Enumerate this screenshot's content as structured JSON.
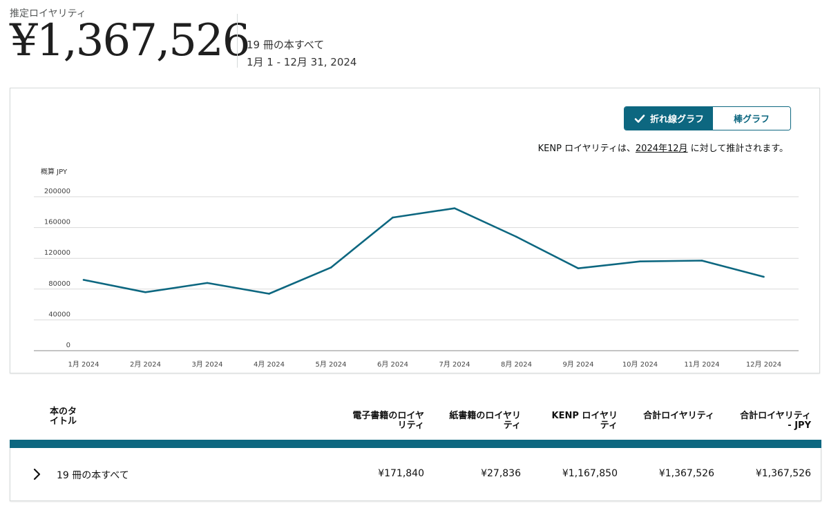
{
  "header": {
    "estimated_label": "推定ロイヤリティ",
    "total": "¥1,367,526",
    "books_label": "19 冊の本すべて",
    "date_range": "1月 1 - 12月 31, 2024"
  },
  "chart_controls": {
    "line_label": "折れ線グラフ",
    "bar_label": "棒グラフ",
    "active": "line"
  },
  "kenp_note": {
    "prefix": "KENP ロイヤリティは、",
    "link": "2024年12月",
    "suffix": " に対して推計されます。"
  },
  "chart_data": {
    "type": "line",
    "ylabel": "概算 JPY",
    "ylim": [
      0,
      200000
    ],
    "yticks": [
      "0",
      "40000",
      "80000",
      "120000",
      "160000",
      "200000"
    ],
    "categories": [
      "1月 2024",
      "2月 2024",
      "3月 2024",
      "4月 2024",
      "5月 2024",
      "6月 2024",
      "7月 2024",
      "8月 2024",
      "9月 2024",
      "10月 2024",
      "11月 2024",
      "12月 2024"
    ],
    "series": [
      {
        "values": [
          92000,
          76000,
          88000,
          74000,
          108000,
          173000,
          185000,
          148000,
          107000,
          116000,
          117000,
          96000
        ],
        "color": "#0d6780"
      }
    ],
    "grid": true
  },
  "table": {
    "headers": {
      "title": "本のタイトル",
      "ebook": "電子書籍のロイヤリティ",
      "print": "紙書籍のロイヤリティ",
      "kenp": "KENP ロイヤリティ",
      "total": "合計ロイヤリティ",
      "total_jpy": "合計ロイヤリティ - JPY"
    },
    "row": {
      "title": "19 冊の本すべて",
      "ebook": "¥171,840",
      "print": "¥27,836",
      "kenp": "¥1,167,850",
      "total": "¥1,367,526",
      "total_jpy": "¥1,367,526"
    }
  },
  "icons": {
    "check": "check-icon",
    "expand": "chevron-right-icon"
  },
  "colors": {
    "accent": "#0d6780"
  }
}
